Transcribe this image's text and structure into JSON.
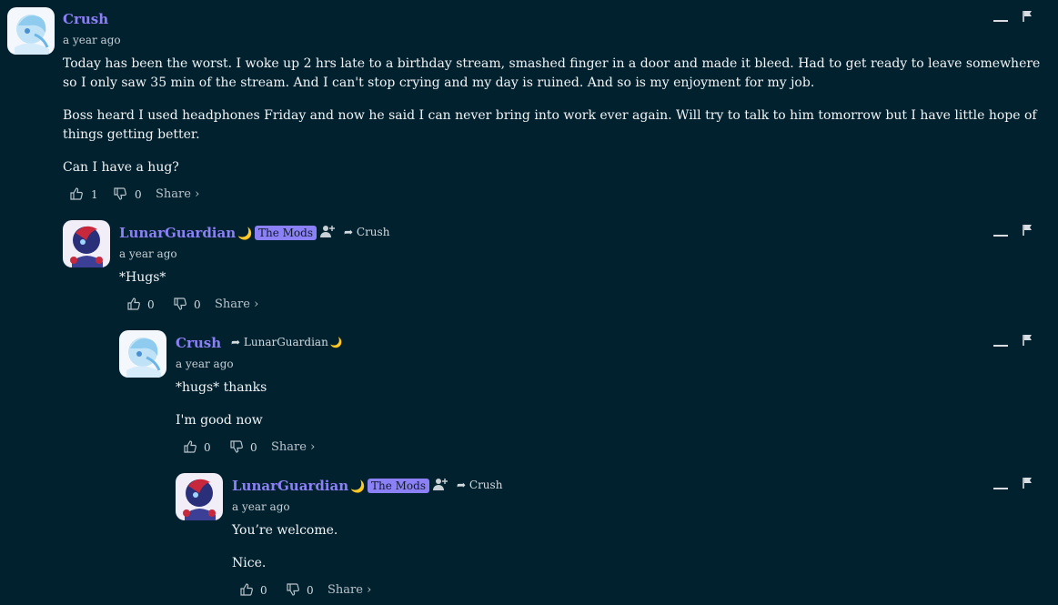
{
  "comments": [
    {
      "author": "Crush",
      "time": "a year ago",
      "paragraphs": [
        "Today has been the worst. I woke up 2 hrs late to a birthday stream, smashed finger in a door and made it bleed. Had to get ready to leave somewhere so I only saw 35 min of the stream. And I can't stop crying and my day is ruined. And so is my enjoyment for my job.",
        "Boss heard I used headphones Friday and now he said I can never bring into work ever again. Will try to talk to him tomorrow but I have little hope of things getting better.",
        "Can I have a hug?"
      ],
      "likes": "1",
      "dislikes": "0",
      "share": "Share ›"
    },
    {
      "author": "LunarGuardian",
      "moon": "🌙",
      "badge": "The Mods",
      "reply_to": "Crush",
      "time": "a year ago",
      "paragraphs": [
        "*Hugs*"
      ],
      "likes": "0",
      "dislikes": "0",
      "share": "Share ›"
    },
    {
      "author": "Crush",
      "reply_to": "LunarGuardian",
      "reply_to_moon": "🌙",
      "time": "a year ago",
      "paragraphs": [
        "*hugs* thanks",
        "I'm good now"
      ],
      "likes": "0",
      "dislikes": "0",
      "share": "Share ›"
    },
    {
      "author": "LunarGuardian",
      "moon": "🌙",
      "badge": "The Mods",
      "reply_to": "Crush",
      "time": "a year ago",
      "paragraphs": [
        "You’re welcome.",
        "Nice."
      ],
      "likes": "0",
      "dislikes": "0",
      "share": "Share ›"
    }
  ],
  "icons": {
    "like": "thumbs-up-icon",
    "dislike": "thumbs-down-icon",
    "minimize": "minimize-icon",
    "flag": "flag-icon",
    "reply_arrow": "reply-arrow-icon",
    "follow": "add-user-icon"
  },
  "colors": {
    "background": "#01212f",
    "author": "#8b80f5",
    "badge": "#8b80f5"
  }
}
